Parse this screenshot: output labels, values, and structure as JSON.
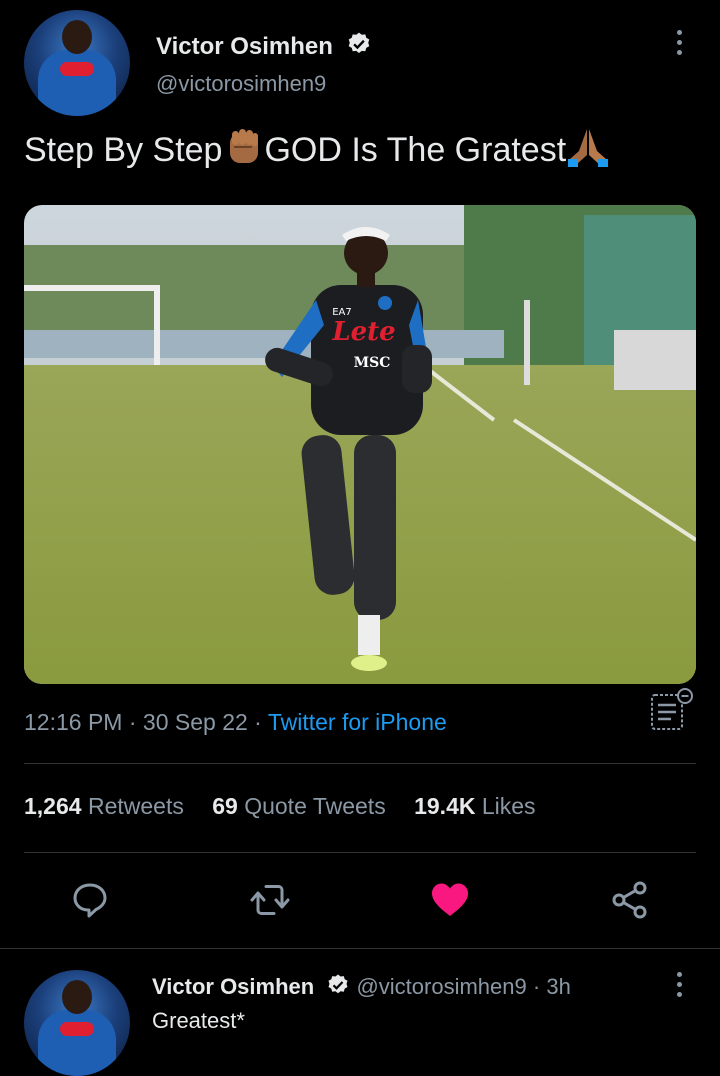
{
  "tweet": {
    "author_name": "Victor Osimhen",
    "author_handle": "@victorosimhen9",
    "text_part1": "Step By Step",
    "text_part2": "GOD Is The Gratest",
    "time": "12:16 PM",
    "date": "30 Sep 22",
    "source": "Twitter for iPhone",
    "sep": "·",
    "media_jersey_text": "Lete",
    "media_sponsor_text": "MSC",
    "media_brand_text": "EA7"
  },
  "stats": {
    "retweets_count": "1,264",
    "retweets_label": "Retweets",
    "quotes_count": "69",
    "quotes_label": "Quote Tweets",
    "likes_count": "19.4K",
    "likes_label": "Likes"
  },
  "actions": {
    "reply_icon": "reply-icon",
    "retweet_icon": "retweet-icon",
    "like_icon": "heart-filled-icon",
    "share_icon": "share-icon",
    "like_color": "#f91880"
  },
  "reply": {
    "author_name": "Victor Osimhen",
    "author_handle": "@victorosimhen9",
    "time_ago": "3h",
    "sep": "·",
    "text": "Greatest*"
  },
  "colors": {
    "background": "#000000",
    "link": "#1d9bf0",
    "secondary_text": "#8b98a5"
  }
}
